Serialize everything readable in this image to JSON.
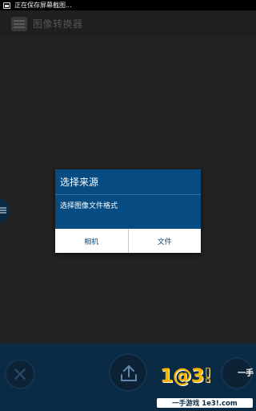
{
  "status_bar": {
    "text": "正在保存屏幕截图..."
  },
  "app_bar": {
    "title": "图像转换器"
  },
  "dialog": {
    "title": "选择来源",
    "message": "选择图像文件格式",
    "buttons": [
      {
        "label": "相机"
      },
      {
        "label": "文件"
      }
    ]
  },
  "bottom_bar": {
    "left_icon": "close-icon",
    "center_icon": "upload-icon"
  },
  "watermark": {
    "digits": "1@3",
    "suffix": "!",
    "side_text": "一手",
    "bar_text": "一手游戏 1e3!.com"
  },
  "colors": {
    "dialog_bg": "#064b82",
    "bottom_bar": "#0b2a44",
    "watermark_yellow": "#f4b400"
  }
}
